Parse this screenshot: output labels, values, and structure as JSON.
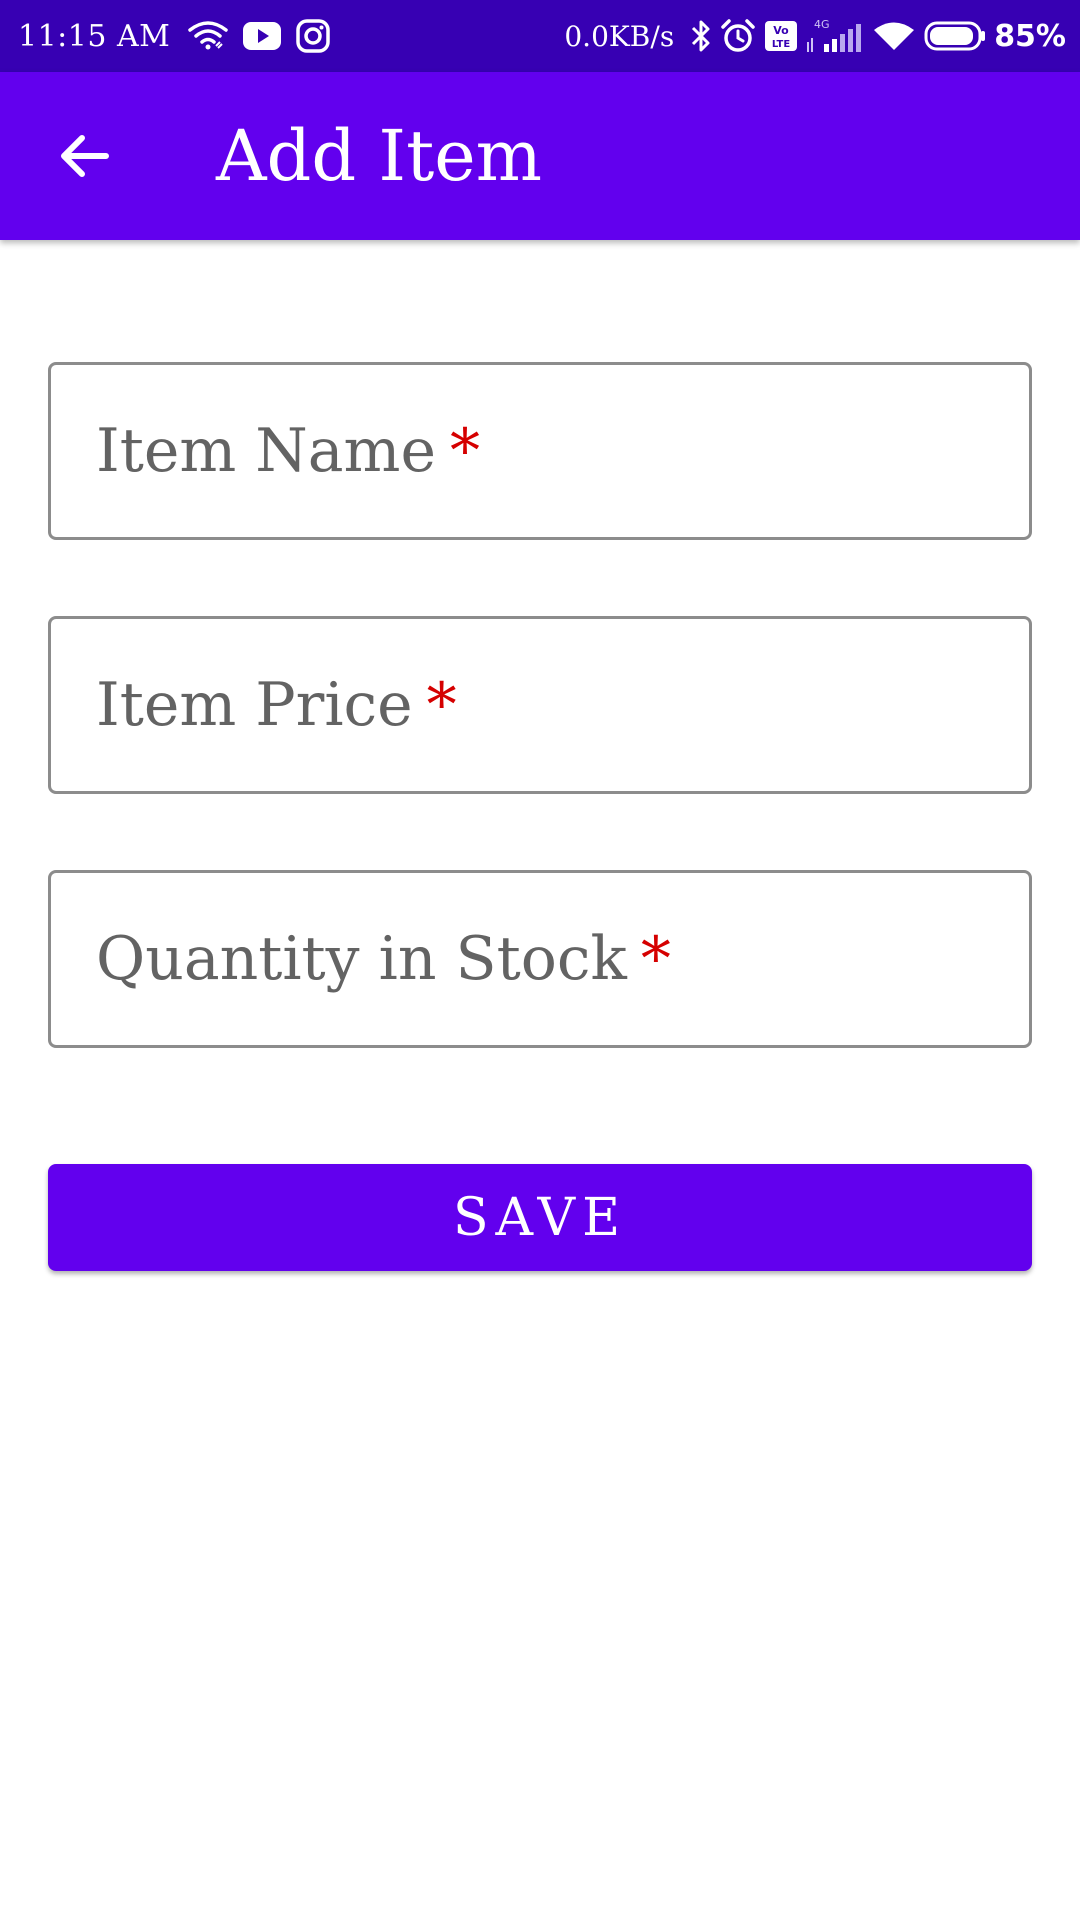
{
  "status_bar": {
    "time": "11:15 AM",
    "network_speed": "0.0KB/s",
    "battery_percent": "85%",
    "left_icons": [
      "wifi-link-icon",
      "youtube-icon",
      "instagram-icon"
    ],
    "right_icons": [
      "bluetooth-icon",
      "alarm-icon",
      "volte-icon",
      "cell-signal-4g-icon",
      "wifi-icon",
      "battery-icon"
    ],
    "network_type": "4G",
    "volte_label": "Vo LTE"
  },
  "app_bar": {
    "title": "Add Item",
    "back_icon": "arrow-back-icon"
  },
  "form": {
    "fields": [
      {
        "label": "Item Name",
        "required_mark": "*",
        "value": ""
      },
      {
        "label": "Item Price",
        "required_mark": "*",
        "value": ""
      },
      {
        "label": "Quantity in Stock",
        "required_mark": "*",
        "value": ""
      }
    ]
  },
  "actions": {
    "save_label": "SAVE"
  },
  "colors": {
    "status_bar_bg": "#3700b3",
    "primary": "#6200ee",
    "required": "#d50000",
    "field_border": "#8c8c8c",
    "label_text": "#636363"
  }
}
